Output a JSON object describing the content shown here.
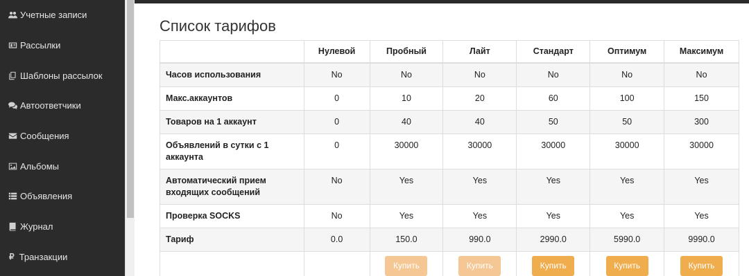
{
  "sidebar": {
    "items": [
      {
        "label": "Учетные записи",
        "icon": "users-icon"
      },
      {
        "label": "Рассылки",
        "icon": "id-card-icon"
      },
      {
        "label": "Шаблоны рассылок",
        "icon": "copy-icon"
      },
      {
        "label": "Автоответчики",
        "icon": "comments-icon"
      },
      {
        "label": "Сообщения",
        "icon": "envelope-icon"
      },
      {
        "label": "Альбомы",
        "icon": "image-icon"
      },
      {
        "label": "Объявления",
        "icon": "list-icon"
      },
      {
        "label": "Журнал",
        "icon": "book-icon"
      },
      {
        "label": "Транзакции",
        "icon": "ruble-icon",
        "glyph": "₽"
      }
    ]
  },
  "page": {
    "title": "Список тарифов"
  },
  "table": {
    "columns": [
      "",
      "Нулевой",
      "Пробный",
      "Лайт",
      "Стандарт",
      "Оптимум",
      "Максимум"
    ],
    "rows": [
      {
        "label": "Часов использования",
        "values": [
          "No",
          "No",
          "No",
          "No",
          "No",
          "No"
        ]
      },
      {
        "label": "Макс.аккаунтов",
        "values": [
          "0",
          "10",
          "20",
          "60",
          "100",
          "150"
        ]
      },
      {
        "label": "Товаров на 1 аккаунт",
        "values": [
          "0",
          "40",
          "40",
          "50",
          "50",
          "300"
        ]
      },
      {
        "label": "Объявлений в сутки с 1 аккаунта",
        "values": [
          "0",
          "30000",
          "30000",
          "30000",
          "30000",
          "30000"
        ]
      },
      {
        "label": "Автоматический прием входящих сообщений",
        "values": [
          "No",
          "Yes",
          "Yes",
          "Yes",
          "Yes",
          "Yes"
        ]
      },
      {
        "label": "Проверка SOCKS",
        "values": [
          "No",
          "Yes",
          "Yes",
          "Yes",
          "Yes",
          "Yes"
        ]
      },
      {
        "label": "Тариф",
        "values": [
          "0.0",
          "150.0",
          "990.0",
          "2990.0",
          "5990.0",
          "9990.0"
        ]
      }
    ],
    "buy_label": "Купить",
    "buy_states": [
      "none",
      "disabled",
      "disabled",
      "enabled",
      "enabled",
      "enabled"
    ]
  },
  "colors": {
    "sidebar_bg": "#2b2b2b",
    "accent_button": "#f0ad4e",
    "accent_button_disabled": "#f5c794"
  }
}
